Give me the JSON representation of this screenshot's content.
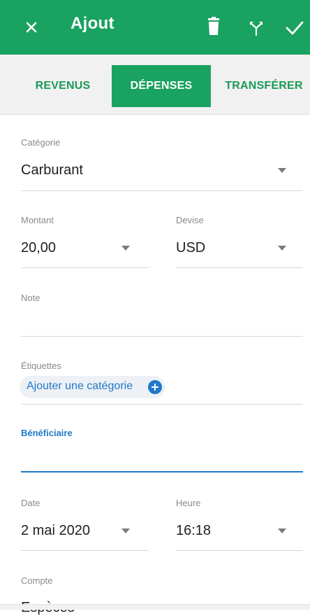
{
  "appbar": {
    "title": "Ajout",
    "background": "#1aa260",
    "icons": [
      "close-icon",
      "trash-icon",
      "split-icon",
      "check-icon"
    ]
  },
  "tabs": [
    {
      "label": "REVENUS",
      "selected": false
    },
    {
      "label": "DÉPENSES",
      "selected": true
    },
    {
      "label": "TRANSFÉRER",
      "selected": false
    }
  ],
  "form": {
    "category": {
      "label": "Catégorie",
      "value": "Carburant"
    },
    "amount": {
      "label": "Montant",
      "value": "20,00"
    },
    "currency": {
      "label": "Devise",
      "value": "USD"
    },
    "note": {
      "label": "Note",
      "value": ""
    },
    "tags": {
      "label": "Étiquettes",
      "add_label": "Ajouter une catégorie"
    },
    "beneficiary": {
      "label": "Bénéficiaire",
      "value": ""
    },
    "date": {
      "label": "Date",
      "value": "2 mai 2020"
    },
    "time": {
      "label": "Heure",
      "value": "16:18"
    },
    "account": {
      "label": "Compte",
      "value": "Espèces"
    }
  },
  "colors": {
    "accent_green": "#1aa260",
    "active_blue": "#1f78c8"
  }
}
